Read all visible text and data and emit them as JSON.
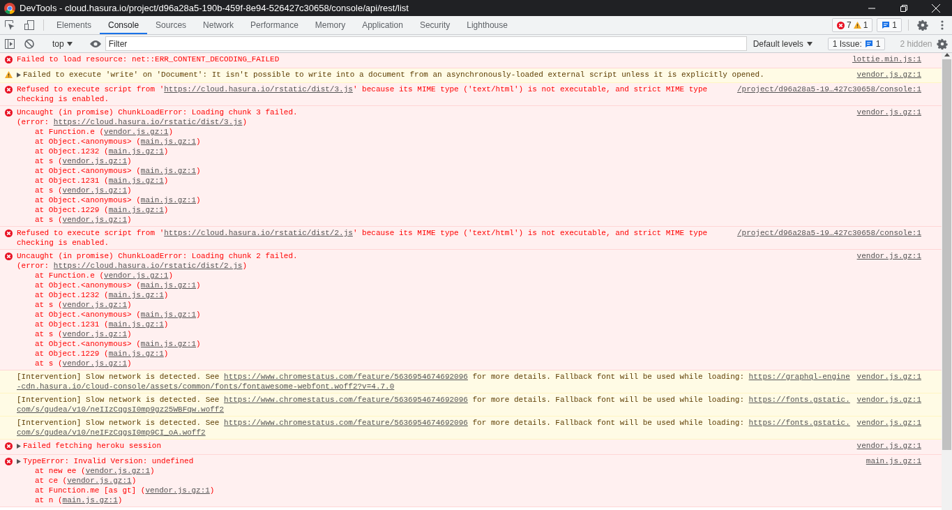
{
  "window": {
    "title": "DevTools - cloud.hasura.io/project/d96a28a5-190b-459f-8e94-526427c30658/console/api/rest/list"
  },
  "tabs": [
    {
      "label": "Elements",
      "selected": false
    },
    {
      "label": "Console",
      "selected": true
    },
    {
      "label": "Sources",
      "selected": false
    },
    {
      "label": "Network",
      "selected": false
    },
    {
      "label": "Performance",
      "selected": false
    },
    {
      "label": "Memory",
      "selected": false
    },
    {
      "label": "Application",
      "selected": false
    },
    {
      "label": "Security",
      "selected": false
    },
    {
      "label": "Lighthouse",
      "selected": false
    }
  ],
  "counters": {
    "errors": "7",
    "warnings": "1",
    "messages": "1"
  },
  "toolbar": {
    "context": "top",
    "filter_placeholder": "Filter",
    "levels": "Default levels",
    "issues_label": "1 Issue:",
    "issues_count": "1",
    "hidden": "2 hidden"
  },
  "messages": [
    {
      "kind": "error",
      "expandable": false,
      "lines": [
        [
          {
            "text": "Failed to load resource: net::ERR_CONTENT_DECODING_FAILED",
            "link": false
          }
        ]
      ],
      "source": "lottie.min.js:1"
    },
    {
      "kind": "warning",
      "expandable": true,
      "lines": [
        [
          {
            "text": "Failed to execute 'write' on 'Document': It isn't possible to write into a document from an asynchronously-loaded external script unless it is explicitly opened.",
            "link": false
          }
        ]
      ],
      "source": "vendor.js.gz:1"
    },
    {
      "kind": "error",
      "expandable": false,
      "lines": [
        [
          {
            "text": "Refused to execute script from '",
            "link": false
          },
          {
            "text": "https://cloud.hasura.io/rstatic/dist/3.js",
            "link": true
          },
          {
            "text": "' because its MIME type ('text/html') is not executable, and strict MIME type",
            "link": false
          }
        ],
        [
          {
            "text": "checking is enabled.",
            "link": false
          }
        ]
      ],
      "source": "/project/d96a28a5-19…427c30658/console:1"
    },
    {
      "kind": "error",
      "expandable": false,
      "lines": [
        [
          {
            "text": "Uncaught (in promise) ChunkLoadError: Loading chunk 3 failed.",
            "link": false
          }
        ],
        [
          {
            "text": "(error: ",
            "link": false
          },
          {
            "text": "https://cloud.hasura.io/rstatic/dist/3.js",
            "link": true
          },
          {
            "text": ")",
            "link": false
          }
        ]
      ],
      "stack": [
        {
          "text": "at Function.e (",
          "source": "vendor.js.gz:1",
          "end": ")"
        },
        {
          "text": "at Object.<anonymous> (",
          "source": "main.js.gz:1",
          "end": ")"
        },
        {
          "text": "at Object.1232 (",
          "source": "main.js.gz:1",
          "end": ")"
        },
        {
          "text": "at s (",
          "source": "vendor.js.gz:1",
          "end": ")"
        },
        {
          "text": "at Object.<anonymous> (",
          "source": "main.js.gz:1",
          "end": ")"
        },
        {
          "text": "at Object.1231 (",
          "source": "main.js.gz:1",
          "end": ")"
        },
        {
          "text": "at s (",
          "source": "vendor.js.gz:1",
          "end": ")"
        },
        {
          "text": "at Object.<anonymous> (",
          "source": "main.js.gz:1",
          "end": ")"
        },
        {
          "text": "at Object.1229 (",
          "source": "main.js.gz:1",
          "end": ")"
        },
        {
          "text": "at s (",
          "source": "vendor.js.gz:1",
          "end": ")"
        }
      ],
      "source": "vendor.js.gz:1"
    },
    {
      "kind": "error",
      "expandable": false,
      "lines": [
        [
          {
            "text": "Refused to execute script from '",
            "link": false
          },
          {
            "text": "https://cloud.hasura.io/rstatic/dist/2.js",
            "link": true
          },
          {
            "text": "' because its MIME type ('text/html') is not executable, and strict MIME type",
            "link": false
          }
        ],
        [
          {
            "text": "checking is enabled.",
            "link": false
          }
        ]
      ],
      "source": "/project/d96a28a5-19…427c30658/console:1"
    },
    {
      "kind": "error",
      "expandable": false,
      "lines": [
        [
          {
            "text": "Uncaught (in promise) ChunkLoadError: Loading chunk 2 failed.",
            "link": false
          }
        ],
        [
          {
            "text": "(error: ",
            "link": false
          },
          {
            "text": "https://cloud.hasura.io/rstatic/dist/2.js",
            "link": true
          },
          {
            "text": ")",
            "link": false
          }
        ]
      ],
      "stack": [
        {
          "text": "at Function.e (",
          "source": "vendor.js.gz:1",
          "end": ")"
        },
        {
          "text": "at Object.<anonymous> (",
          "source": "main.js.gz:1",
          "end": ")"
        },
        {
          "text": "at Object.1232 (",
          "source": "main.js.gz:1",
          "end": ")"
        },
        {
          "text": "at s (",
          "source": "vendor.js.gz:1",
          "end": ")"
        },
        {
          "text": "at Object.<anonymous> (",
          "source": "main.js.gz:1",
          "end": ")"
        },
        {
          "text": "at Object.1231 (",
          "source": "main.js.gz:1",
          "end": ")"
        },
        {
          "text": "at s (",
          "source": "vendor.js.gz:1",
          "end": ")"
        },
        {
          "text": "at Object.<anonymous> (",
          "source": "main.js.gz:1",
          "end": ")"
        },
        {
          "text": "at Object.1229 (",
          "source": "main.js.gz:1",
          "end": ")"
        },
        {
          "text": "at s (",
          "source": "vendor.js.gz:1",
          "end": ")"
        }
      ],
      "source": "vendor.js.gz:1"
    },
    {
      "kind": "intervention",
      "expandable": false,
      "lines": [
        [
          {
            "text": "[Intervention] Slow network is detected. See ",
            "link": false
          },
          {
            "text": "https://www.chromestatus.com/feature/5636954674692096",
            "link": true
          },
          {
            "text": " for more details. Fallback font will be used while loading: ",
            "link": false
          },
          {
            "text": "https://graphql-engine",
            "link": true
          }
        ],
        [
          {
            "text": "-cdn.hasura.io/cloud-console/assets/common/fonts/fontawesome-webfont.woff2?v=4.7.0",
            "link": true
          }
        ]
      ],
      "source": "vendor.js.gz:1"
    },
    {
      "kind": "intervention",
      "expandable": false,
      "lines": [
        [
          {
            "text": "[Intervention] Slow network is detected. See ",
            "link": false
          },
          {
            "text": "https://www.chromestatus.com/feature/5636954674692096",
            "link": true
          },
          {
            "text": " for more details. Fallback font will be used while loading: ",
            "link": false
          },
          {
            "text": "https://fonts.gstatic.",
            "link": true
          }
        ],
        [
          {
            "text": "com/s/gudea/v10/neIIzCqgsI0mp9gz25WBFqw.woff2",
            "link": true
          }
        ]
      ],
      "source": "vendor.js.gz:1"
    },
    {
      "kind": "intervention",
      "expandable": false,
      "lines": [
        [
          {
            "text": "[Intervention] Slow network is detected. See ",
            "link": false
          },
          {
            "text": "https://www.chromestatus.com/feature/5636954674692096",
            "link": true
          },
          {
            "text": " for more details. Fallback font will be used while loading: ",
            "link": false
          },
          {
            "text": "https://fonts.gstatic.",
            "link": true
          }
        ],
        [
          {
            "text": "com/s/gudea/v10/neIFzCqgsI0mp9CI_oA.woff2",
            "link": true
          }
        ]
      ],
      "source": "vendor.js.gz:1"
    },
    {
      "kind": "error",
      "expandable": true,
      "lines": [
        [
          {
            "text": "Failed fetching heroku session",
            "link": false
          }
        ]
      ],
      "source": "vendor.js.gz:1"
    },
    {
      "kind": "error",
      "expandable": true,
      "lines": [
        [
          {
            "text": "TypeError: Invalid Version: undefined",
            "link": false
          }
        ]
      ],
      "stack": [
        {
          "text": "at new ee (",
          "source": "vendor.js.gz:1",
          "end": ")"
        },
        {
          "text": "at ce (",
          "source": "vendor.js.gz:1",
          "end": ")"
        },
        {
          "text": "at Function.me [as gt] (",
          "source": "vendor.js.gz:1",
          "end": ")"
        },
        {
          "text": "at n (",
          "source": "main.js.gz:1",
          "end": ")"
        }
      ],
      "source": "main.js.gz:1"
    }
  ]
}
